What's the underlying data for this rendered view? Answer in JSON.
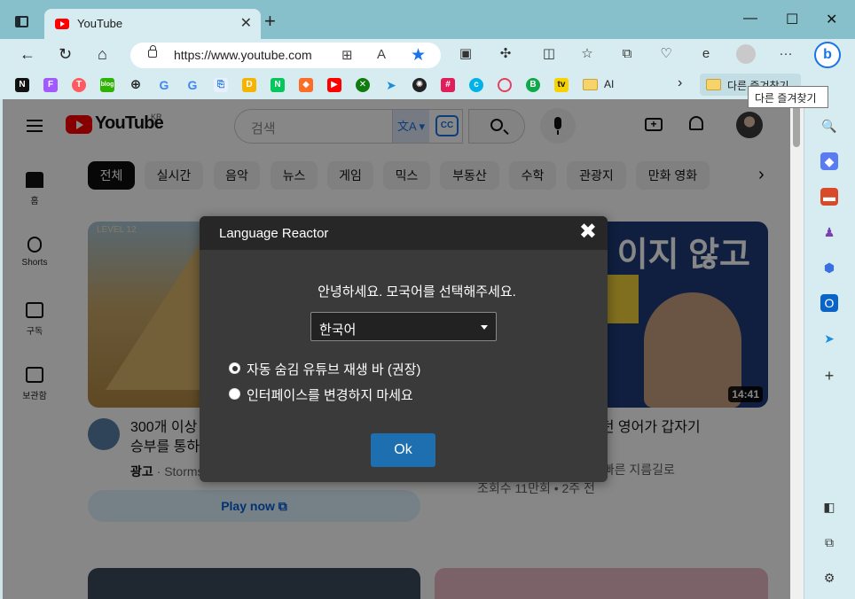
{
  "browser": {
    "tab_title": "YouTube",
    "url": "https://www.youtube.com",
    "favorites": [
      "N",
      "F",
      "T",
      "blog",
      "globe",
      "G",
      "G",
      "wp",
      "D",
      "N",
      "GL",
      "YT",
      "xbox",
      "fly",
      "AI-bot",
      "slack",
      "chat",
      "toggle",
      "B",
      "tv"
    ],
    "fav_folder_label": "AI",
    "other_favorites_label": "다른 즐겨찾기",
    "tooltip": "다른 즐겨찾기"
  },
  "youtube": {
    "logo_text": "YouTube",
    "region": "KR",
    "search_placeholder": "검색",
    "cc_badge": "CC",
    "sidebar": [
      {
        "label": "홈",
        "icon": "home-icon"
      },
      {
        "label": "Shorts",
        "icon": "shorts-icon"
      },
      {
        "label": "구독",
        "icon": "subscriptions-icon"
      },
      {
        "label": "보관함",
        "icon": "library-icon"
      }
    ],
    "chips": [
      "전체",
      "실시간",
      "음악",
      "뉴스",
      "게임",
      "믹스",
      "부동산",
      "수학",
      "관광지",
      "만화 영화"
    ],
    "videos": [
      {
        "title_line1": "300개 이상",
        "title_line2": "승부를 통하",
        "ad_label": "광고",
        "channel": "· Storms",
        "thumb_tag": "LEVEL 12",
        "cta": "Play now"
      },
      {
        "thumb_text": "이지 않고",
        "duration": "14:41",
        "title": "리던 영어가 갑자기",
        "meta_line1": "는 빠른 지름길로",
        "meta_line2": "조회수 11만회 • 2주 전"
      }
    ]
  },
  "modal": {
    "title": "Language Reactor",
    "close": "✖",
    "greeting": "안녕하세요. 모국어를 선택해주세요.",
    "selected_language": "한국어",
    "options": [
      {
        "label": "자동 숨김 유튜브 재생 바 (권장)",
        "checked": true
      },
      {
        "label": "인터페이스를 변경하지 마세요",
        "checked": false
      }
    ],
    "ok_label": "Ok"
  }
}
